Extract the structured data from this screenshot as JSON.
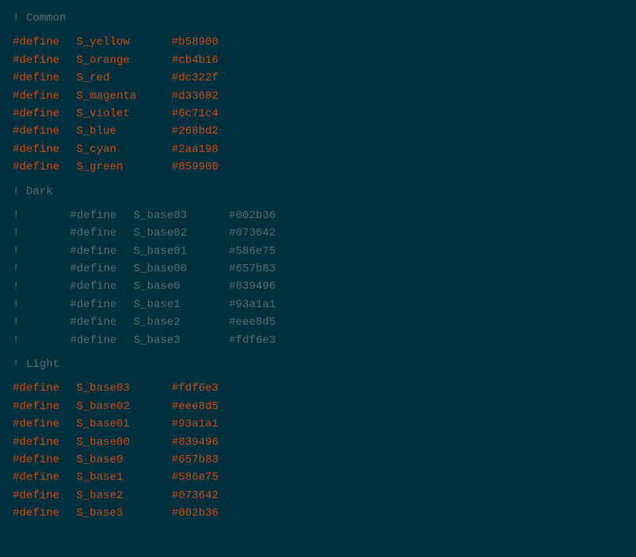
{
  "editor": {
    "background": "#00303d",
    "sections": [
      {
        "id": "common",
        "comment": "! Common",
        "blank_before": false,
        "lines": [
          {
            "type": "define",
            "commented": false,
            "name": "S_yellow",
            "value": "#b58900"
          },
          {
            "type": "define",
            "commented": false,
            "name": "S_orange",
            "value": "#cb4b16"
          },
          {
            "type": "define",
            "commented": false,
            "name": "S_red",
            "value": "#dc322f"
          },
          {
            "type": "define",
            "commented": false,
            "name": "S_magenta",
            "value": "#d33682"
          },
          {
            "type": "define",
            "commented": false,
            "name": "S_violet",
            "value": "#6c71c4"
          },
          {
            "type": "define",
            "commented": false,
            "name": "S_blue",
            "value": "#268bd2"
          },
          {
            "type": "define",
            "commented": false,
            "name": "S_cyan",
            "value": "#2aa198"
          },
          {
            "type": "define",
            "commented": false,
            "name": "S_green",
            "value": "#859900"
          }
        ]
      },
      {
        "id": "dark",
        "comment": "! Dark",
        "blank_before": true,
        "lines": [
          {
            "type": "define",
            "commented": true,
            "name": "S_base03",
            "value": "#002b36"
          },
          {
            "type": "define",
            "commented": true,
            "name": "S_base02",
            "value": "#073642"
          },
          {
            "type": "define",
            "commented": true,
            "name": "S_base01",
            "value": "#586e75"
          },
          {
            "type": "define",
            "commented": true,
            "name": "S_base00",
            "value": "#657b83"
          },
          {
            "type": "define",
            "commented": true,
            "name": "S_base0",
            "value": "#839496"
          },
          {
            "type": "define",
            "commented": true,
            "name": "S_base1",
            "value": "#93a1a1"
          },
          {
            "type": "define",
            "commented": true,
            "name": "S_base2",
            "value": "#eee8d5"
          },
          {
            "type": "define",
            "commented": true,
            "name": "S_base3",
            "value": "#fdf6e3"
          }
        ]
      },
      {
        "id": "light",
        "comment": "! Light",
        "blank_before": true,
        "lines": [
          {
            "type": "define",
            "commented": false,
            "name": "S_base03",
            "value": "#fdf6e3"
          },
          {
            "type": "define",
            "commented": false,
            "name": "S_base02",
            "value": "#eee8d5"
          },
          {
            "type": "define",
            "commented": false,
            "name": "S_base01",
            "value": "#93a1a1"
          },
          {
            "type": "define",
            "commented": false,
            "name": "S_base00",
            "value": "#839496"
          },
          {
            "type": "define",
            "commented": false,
            "name": "S_base0",
            "value": "#657b83"
          },
          {
            "type": "define",
            "commented": false,
            "name": "S_base1",
            "value": "#586e75"
          },
          {
            "type": "define",
            "commented": false,
            "name": "S_base2",
            "value": "#073642"
          },
          {
            "type": "define",
            "commented": false,
            "name": "S_base3",
            "value": "#002b36"
          }
        ]
      }
    ]
  }
}
